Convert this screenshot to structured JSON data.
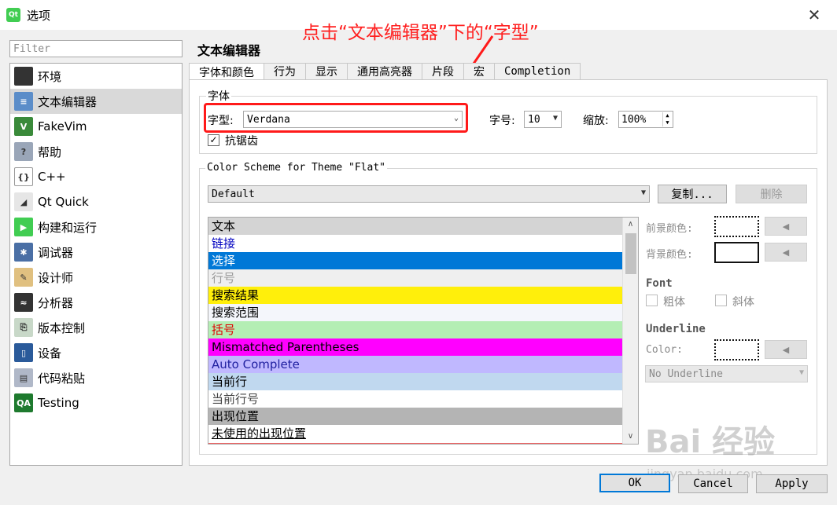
{
  "window": {
    "title": "选项",
    "app_icon": "Qt",
    "close_glyph": "✕"
  },
  "annotation": "点击“文本编辑器”下的“字型”",
  "filter": {
    "placeholder": "Filter"
  },
  "nav": {
    "items": [
      {
        "label": "环境",
        "icon": "monitor-icon",
        "icon_bg": "#333333",
        "icon_text": ""
      },
      {
        "label": "文本编辑器",
        "icon": "text-editor-icon",
        "icon_bg": "#5b8dc9",
        "icon_text": "≡",
        "selected": true
      },
      {
        "label": "FakeVim",
        "icon": "fakevim-icon",
        "icon_bg": "#3a8a3a",
        "icon_text": "V"
      },
      {
        "label": "帮助",
        "icon": "help-icon",
        "icon_bg": "#9aa6b8",
        "icon_text": "?"
      },
      {
        "label": "C++",
        "icon": "cpp-icon",
        "icon_bg": "#ffffff",
        "icon_text": "{}"
      },
      {
        "label": "Qt Quick",
        "icon": "qt-quick-icon",
        "icon_bg": "#e6e6e6",
        "icon_text": "◢"
      },
      {
        "label": "构建和运行",
        "icon": "build-run-icon",
        "icon_bg": "#41cd52",
        "icon_text": "▶"
      },
      {
        "label": "调试器",
        "icon": "debugger-icon",
        "icon_bg": "#4a6fa5",
        "icon_text": "✱"
      },
      {
        "label": "设计师",
        "icon": "designer-icon",
        "icon_bg": "#e0c080",
        "icon_text": "✎"
      },
      {
        "label": "分析器",
        "icon": "analyzer-icon",
        "icon_bg": "#333333",
        "icon_text": "≈"
      },
      {
        "label": "版本控制",
        "icon": "version-control-icon",
        "icon_bg": "#c8d8c8",
        "icon_text": "⎘"
      },
      {
        "label": "设备",
        "icon": "device-icon",
        "icon_bg": "#2a5a9a",
        "icon_text": "▯"
      },
      {
        "label": "代码粘贴",
        "icon": "code-paste-icon",
        "icon_bg": "#b0b8c8",
        "icon_text": "▤"
      },
      {
        "label": "Testing",
        "icon": "testing-icon",
        "icon_bg": "#1e7a2e",
        "icon_text": "QA"
      }
    ]
  },
  "section_title": "文本编辑器",
  "tabs": [
    {
      "label": "字体和颜色",
      "active": true
    },
    {
      "label": "行为"
    },
    {
      "label": "显示"
    },
    {
      "label": "通用高亮器"
    },
    {
      "label": "片段"
    },
    {
      "label": "宏"
    },
    {
      "label": "Completion"
    }
  ],
  "font_group": {
    "title": "字体",
    "family_label": "字型:",
    "family_value": "Verdana",
    "size_label": "字号:",
    "size_value": "10",
    "zoom_label": "缩放:",
    "zoom_value": "100%",
    "antialias_label": "抗锯齿",
    "antialias_checked": true
  },
  "scheme_group": {
    "title": "Color Scheme for Theme \"Flat\"",
    "scheme_value": "Default",
    "copy_button": "复制...",
    "delete_button": "删除"
  },
  "color_list": [
    {
      "label": "文本",
      "bg": "#d4d4d4",
      "fg": "#000000"
    },
    {
      "label": "链接",
      "bg": "#ffffff",
      "fg": "#0000c0"
    },
    {
      "label": "选择",
      "bg": "#0078d7",
      "fg": "#ffffff"
    },
    {
      "label": "行号",
      "bg": "#efefef",
      "fg": "#9a9a9a"
    },
    {
      "label": "搜索结果",
      "bg": "#ffef0b",
      "fg": "#000000"
    },
    {
      "label": "搜索范围",
      "bg": "#f4f6fb",
      "fg": "#000000"
    },
    {
      "label": "括号",
      "bg": "#b4eeb4",
      "fg": "#e00000"
    },
    {
      "label": "Mismatched Parentheses",
      "bg": "#ff00ff",
      "fg": "#000000"
    },
    {
      "label": "Auto Complete",
      "bg": "#c0b8ff",
      "fg": "#2020a0"
    },
    {
      "label": "当前行",
      "bg": "#c0d8ef",
      "fg": "#000000"
    },
    {
      "label": "当前行号",
      "bg": "#ffffff",
      "fg": "#444444"
    },
    {
      "label": "出现位置",
      "bg": "#b4b4b4",
      "fg": "#000000"
    },
    {
      "label": "未使用的出现位置",
      "bg": "#ffffff",
      "fg": "#000000",
      "underline": true
    }
  ],
  "color_props": {
    "foreground_label": "前景颜色:",
    "background_label": "背景颜色:",
    "font_heading": "Font",
    "bold_label": "粗体",
    "italic_label": "斜体",
    "underline_heading": "Underline",
    "color_label": "Color:",
    "underline_style": "No Underline",
    "arrow_glyph": "◀"
  },
  "dialog_buttons": {
    "ok": "OK",
    "cancel": "Cancel",
    "apply": "Apply"
  },
  "watermark": {
    "main": "Bai 经验",
    "sub": "jingyan.baidu.com"
  }
}
